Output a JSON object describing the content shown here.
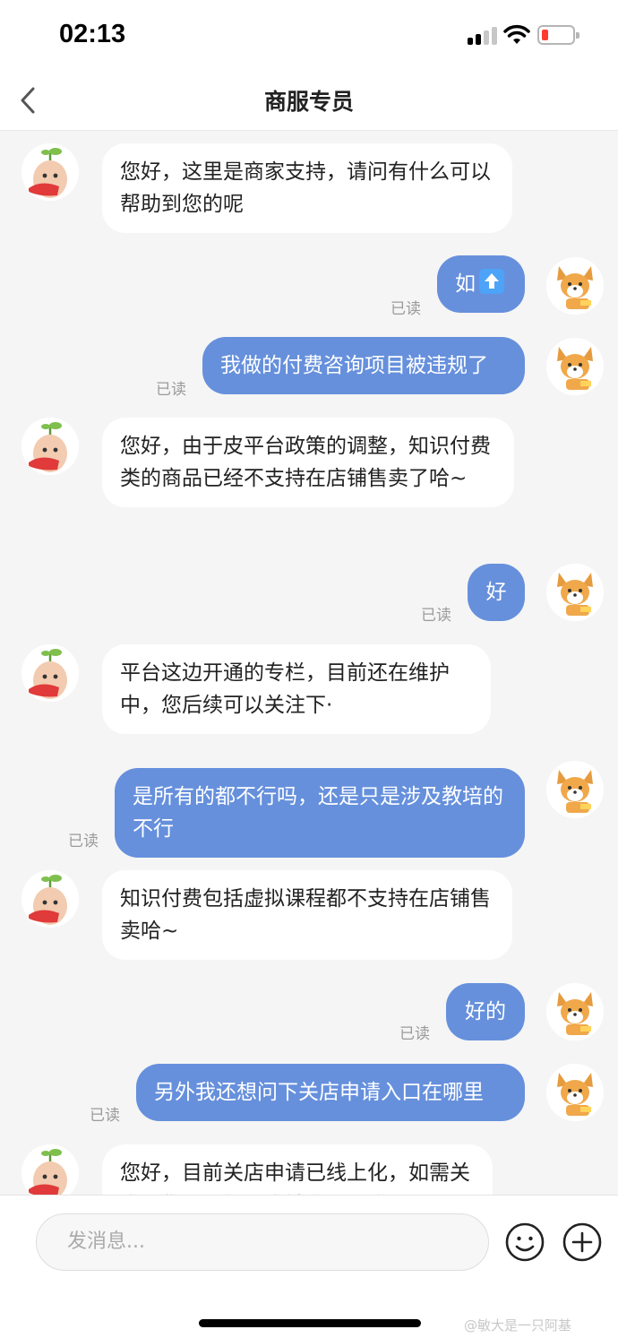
{
  "status_bar": {
    "time": "02:13"
  },
  "nav": {
    "title": "商服专员"
  },
  "messages": [
    {
      "side": "in",
      "text": "您好，这里是商家支持，请问有什么可以帮助到您的呢"
    },
    {
      "side": "out",
      "text": "如",
      "emoji": "up-arrow-emoji",
      "status": "已读"
    },
    {
      "side": "out",
      "text": "我做的付费咨询项目被违规了",
      "status": "已读"
    },
    {
      "side": "in",
      "text": "您好，由于皮平台政策的调整，知识付费类的商品已经不支持在店铺售卖了哈~"
    },
    {
      "side": "out",
      "text": "好",
      "status": "已读"
    },
    {
      "side": "in",
      "text": "平台这边开通的专栏，目前还在维护中，您后续可以关注下·"
    },
    {
      "side": "out",
      "text": "是所有的都不行吗，还是只是涉及教培的不行",
      "status": "已读"
    },
    {
      "side": "in",
      "text": "知识付费包括虚拟课程都不支持在店铺售卖哈~"
    },
    {
      "side": "out",
      "text": "好的",
      "status": "已读"
    },
    {
      "side": "out",
      "text": "另外我还想问下关店申请入口在哪里",
      "status": "已读"
    },
    {
      "side": "in",
      "text": "您好，目前关店申请已线上化，如需关店，您需要使用店铺主账号登录APK后"
    }
  ],
  "input": {
    "placeholder": "发消息..."
  },
  "watermark": "@敏大是一只阿基",
  "colors": {
    "outgoing_bubble": "#6690dc",
    "incoming_bubble": "#ffffff",
    "background": "#f5f5f5"
  }
}
